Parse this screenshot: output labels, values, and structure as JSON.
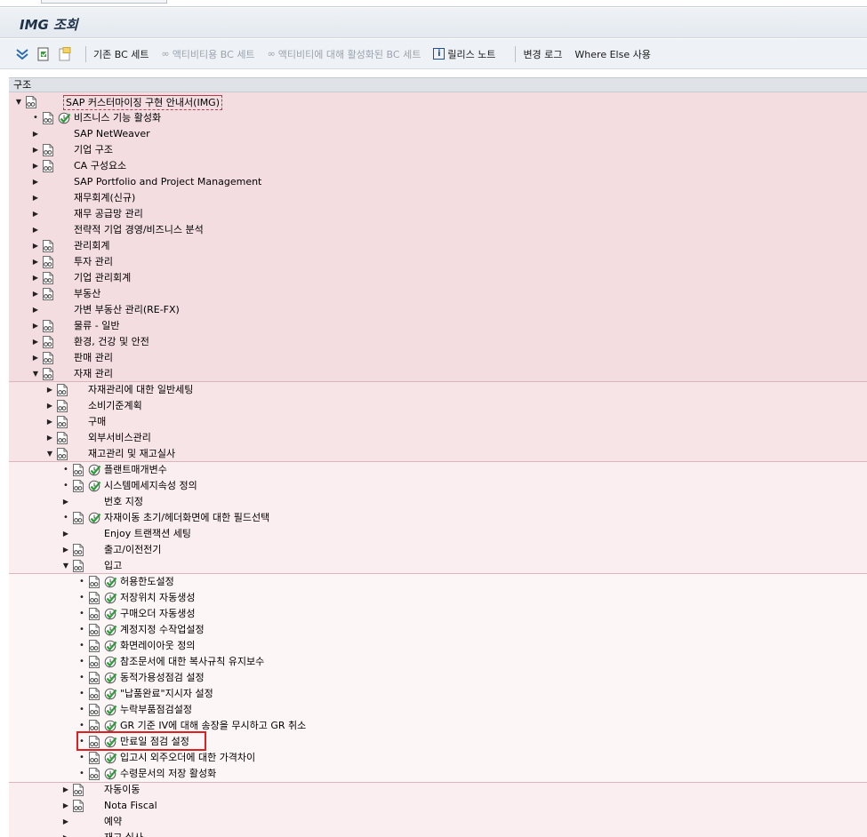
{
  "window": {
    "title": "IMG 조회"
  },
  "toolbar": {
    "items": [
      {
        "label": "기존 BC 세트",
        "enabled": true
      },
      {
        "label": "액티비티용 BC 세트",
        "enabled": false
      },
      {
        "label": "액티비티에 대해 활성화된 BC 세트",
        "enabled": false
      },
      {
        "label": "릴리스 노트",
        "enabled": true
      },
      {
        "label": "변경 로그",
        "enabled": true
      },
      {
        "label": "Where Else 사용",
        "enabled": true
      }
    ]
  },
  "tree": {
    "header": "구조",
    "root": "SAP 커스터마이징 구현 안내서(IMG)",
    "level1": [
      "비즈니스 기능 활성화",
      "SAP NetWeaver",
      "기업 구조",
      "CA 구성요소",
      "SAP Portfolio and Project Management",
      "재무회계(신규)",
      "재무 공급망 관리",
      "전략적 기업 경영/비즈니스 분석",
      "관리회계",
      "투자 관리",
      "기업 관리회계",
      "부동산",
      "가변 부동산 관리(RE-FX)",
      "물류 - 일반",
      "환경, 건강 및 안전",
      "판매 관리",
      "자재 관리"
    ],
    "level2": [
      "자재관리에 대한 일반세팅",
      "소비기준계획",
      "구매",
      "외부서비스관리",
      "재고관리 및 재고실사"
    ],
    "level3": [
      "플랜트매개변수",
      "시스템메세지속성 정의",
      "번호 지정",
      "자재이동 초기/헤더화면에 대한 필드선택",
      "Enjoy 트랜잭션 세팅",
      "출고/이전전기",
      "입고"
    ],
    "level4": [
      "허용한도설정",
      "저장위치 자동생성",
      "구매오더 자동생성",
      "계정지정 수작업설정",
      "화면레이아웃 정의",
      "참조문서에 대한 복사규칙 유지보수",
      "동적가용성점검 설정",
      "\"납품완료\"지시자 설정",
      "누락부품점검설정",
      "GR 기준 IV에 대해 송장을 무시하고 GR 취소",
      "만료일 점검 설정",
      "입고시 외주오더에 대한 가격차이",
      "수령문서의 저장 활성화"
    ],
    "level3_after": [
      "자동이동",
      "Nota Fiscal",
      "예약",
      "재고 실사"
    ],
    "selected": "만료일 점검 설정"
  },
  "colors": {
    "level1_bg": "#f3dde1",
    "level2_bg": "#f7e4e7",
    "level3_bg": "#fbeef0",
    "level4_bg": "#fdf6f7",
    "highlight": "#e02020",
    "activity_green": "#2e9e3a"
  },
  "icons": {
    "doc": "document-glasses-icon",
    "activity": "execute-clock-icon",
    "help_doc": "help-document-icon"
  }
}
